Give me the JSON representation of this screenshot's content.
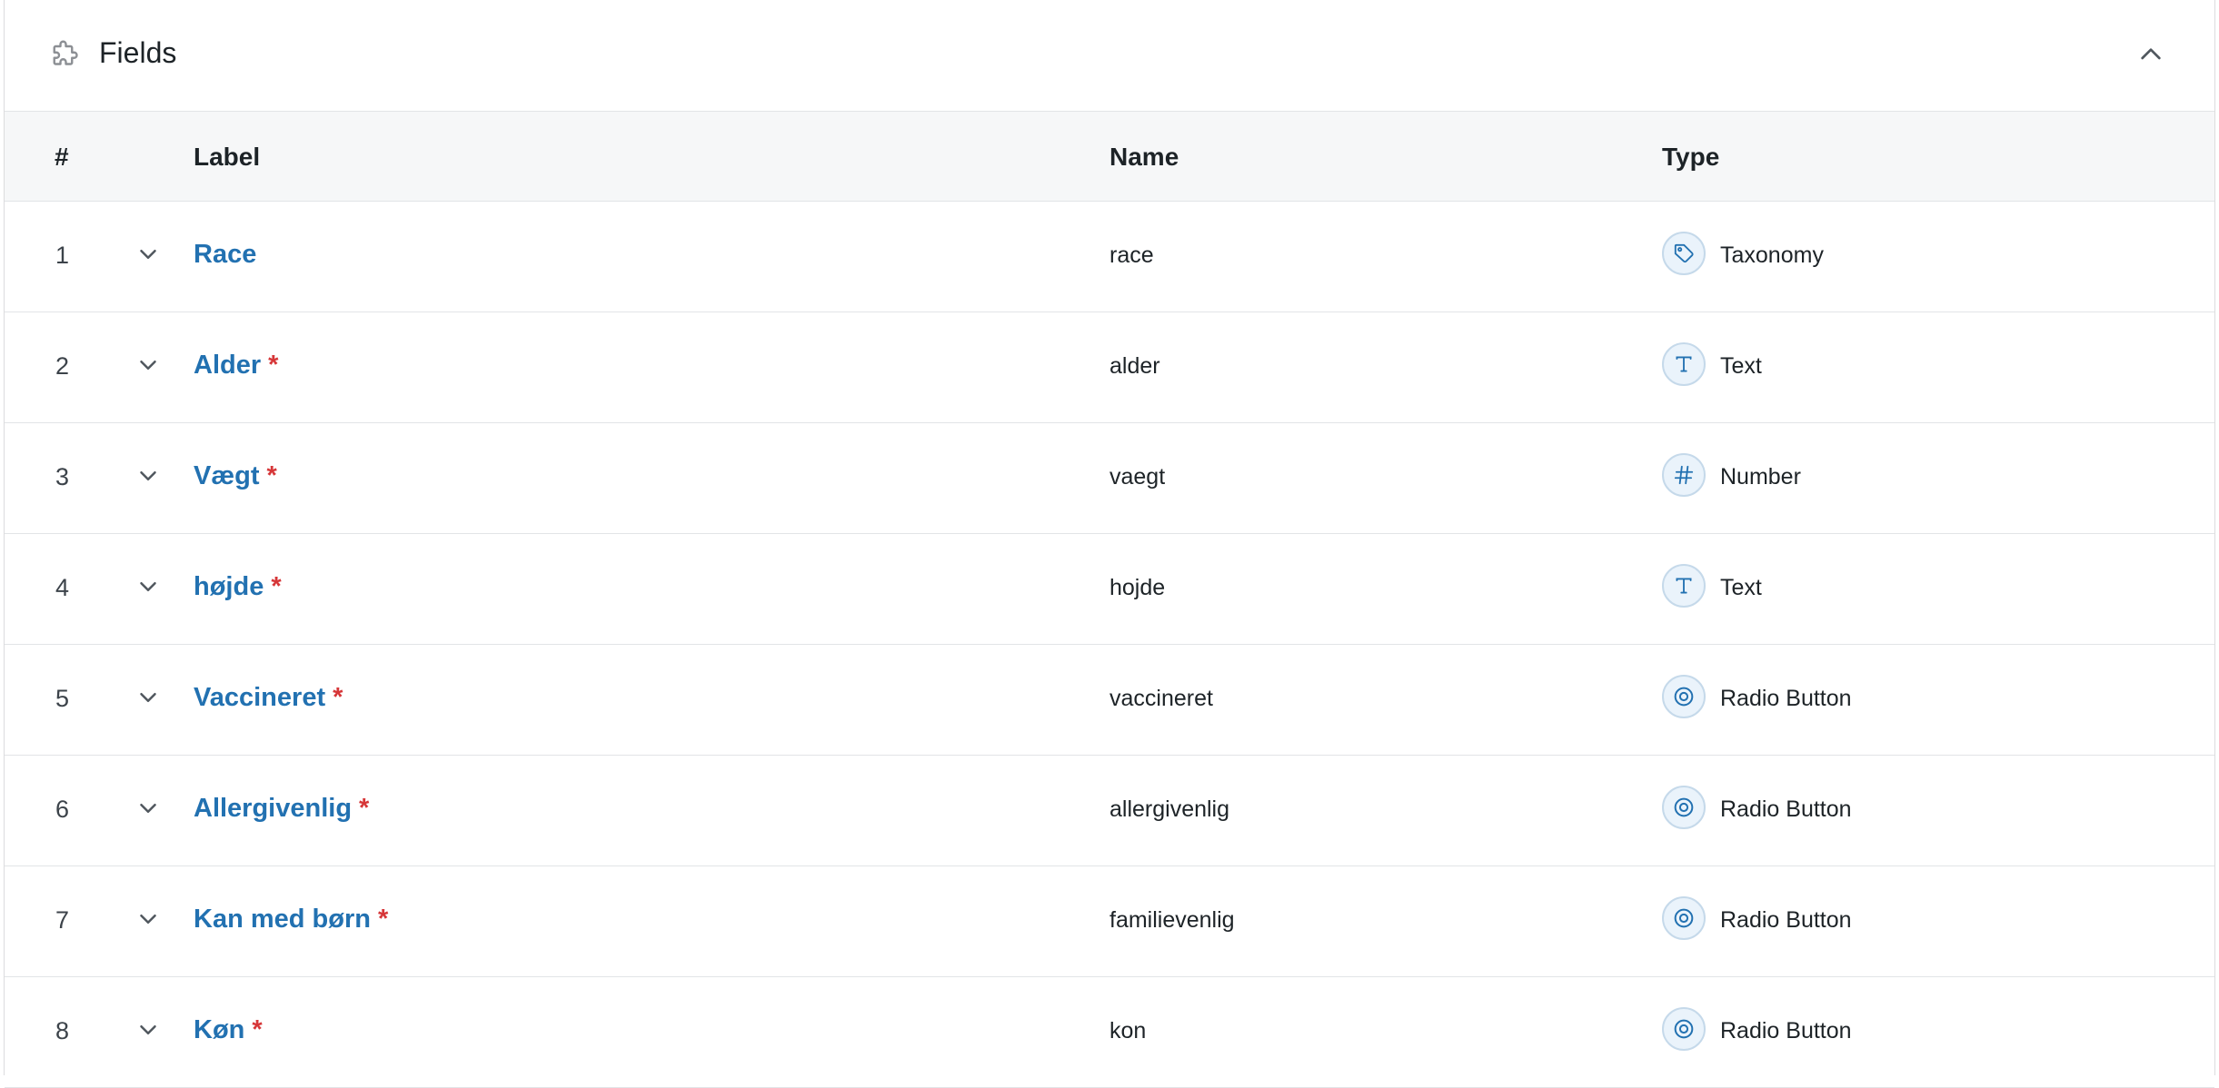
{
  "panel": {
    "title": "Fields",
    "icon": "puzzle-icon",
    "collapse_icon": "chevron-up-icon"
  },
  "table": {
    "headers": {
      "num": "#",
      "label": "Label",
      "name": "Name",
      "type": "Type"
    },
    "rows": [
      {
        "num": "1",
        "label": "Race",
        "required": false,
        "required_mark": "",
        "name": "race",
        "type": "Taxonomy",
        "type_icon": "tag-icon"
      },
      {
        "num": "2",
        "label": "Alder",
        "required": true,
        "required_mark": "*",
        "name": "alder",
        "type": "Text",
        "type_icon": "text-icon"
      },
      {
        "num": "3",
        "label": "Vægt",
        "required": true,
        "required_mark": "*",
        "name": "vaegt",
        "type": "Number",
        "type_icon": "hash-icon"
      },
      {
        "num": "4",
        "label": "højde",
        "required": true,
        "required_mark": "*",
        "name": "hojde",
        "type": "Text",
        "type_icon": "text-icon"
      },
      {
        "num": "5",
        "label": "Vaccineret",
        "required": true,
        "required_mark": "*",
        "name": "vaccineret",
        "type": "Radio Button",
        "type_icon": "radio-icon"
      },
      {
        "num": "6",
        "label": "Allergivenlig",
        "required": true,
        "required_mark": "*",
        "name": "allergivenlig",
        "type": "Radio Button",
        "type_icon": "radio-icon"
      },
      {
        "num": "7",
        "label": "Kan med børn",
        "required": true,
        "required_mark": "*",
        "name": "familievenlig",
        "type": "Radio Button",
        "type_icon": "radio-icon"
      },
      {
        "num": "8",
        "label": "Køn",
        "required": true,
        "required_mark": "*",
        "name": "kon",
        "type": "Radio Button",
        "type_icon": "radio-icon"
      }
    ]
  },
  "colors": {
    "accent": "#2271b1",
    "required": "#d63638",
    "header_bg": "#f6f7f8",
    "icon_bg": "#eaf3fb"
  }
}
